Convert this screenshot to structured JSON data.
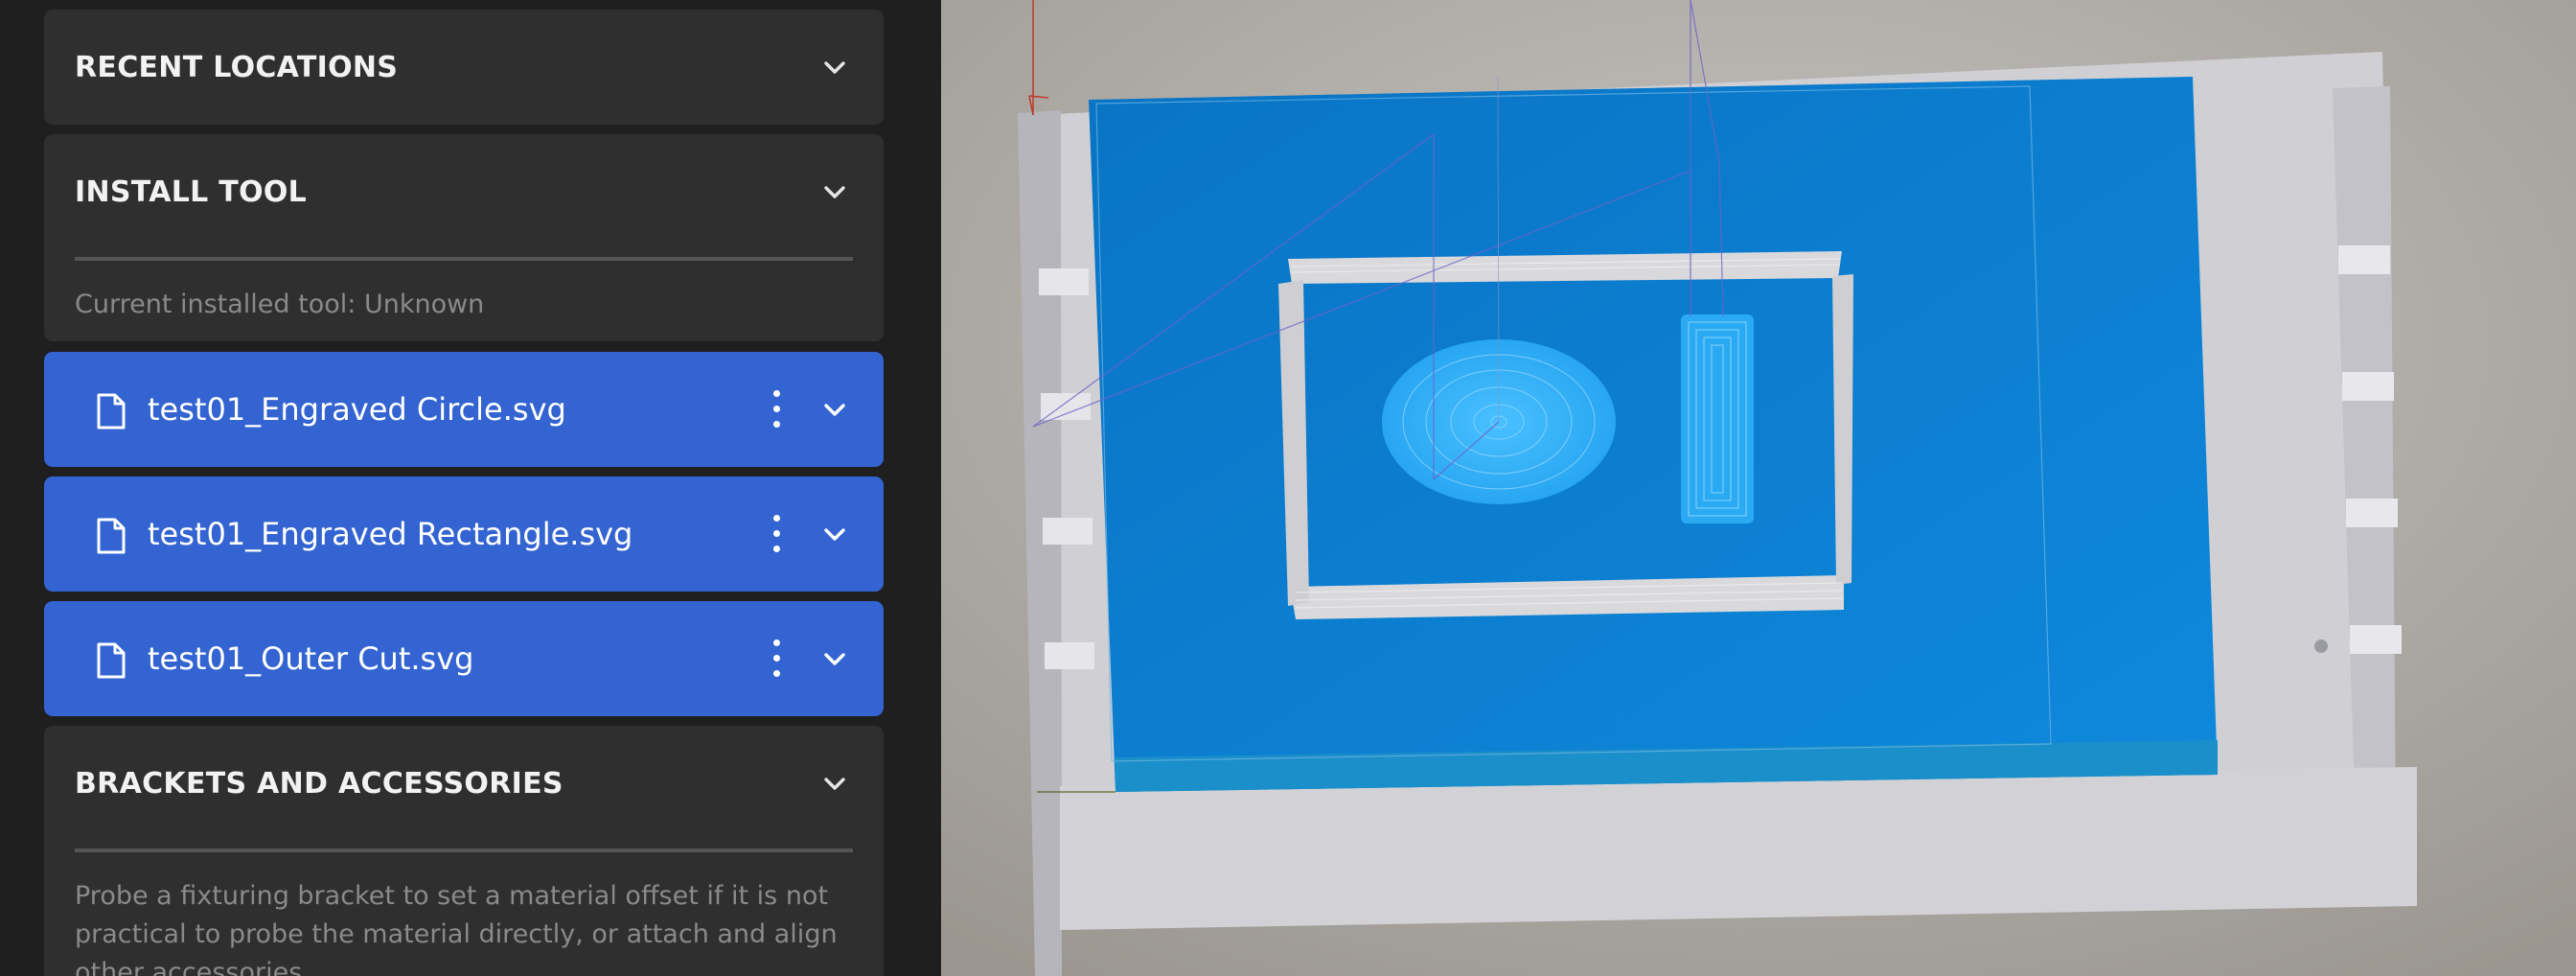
{
  "sidebar": {
    "recent_locations": {
      "title": "RECENT LOCATIONS"
    },
    "install_tool": {
      "title": "INSTALL TOOL",
      "status": "Current installed tool: Unknown"
    },
    "files": [
      {
        "name": "test01_Engraved Circle.svg"
      },
      {
        "name": "test01_Engraved Rectangle.svg"
      },
      {
        "name": "test01_Outer Cut.svg"
      }
    ],
    "brackets": {
      "title": "BRACKETS AND ACCESSORIES",
      "description": "Probe a fixturing bracket to set a material offset if it is not practical to probe the material directly, or attach and align other accessories."
    }
  },
  "colors": {
    "sidebar_bg": "#1f1f1f",
    "card_bg": "#2f2f2f",
    "file_row_bg": "#3364d1",
    "material_blue": "#0a7bd0",
    "toolpath_cyan": "#39b7ff",
    "bed_gray": "#cdcdd2"
  },
  "icons": {
    "expand": "chevron-down-icon",
    "file": "file-icon",
    "menu": "kebab-menu-icon"
  }
}
